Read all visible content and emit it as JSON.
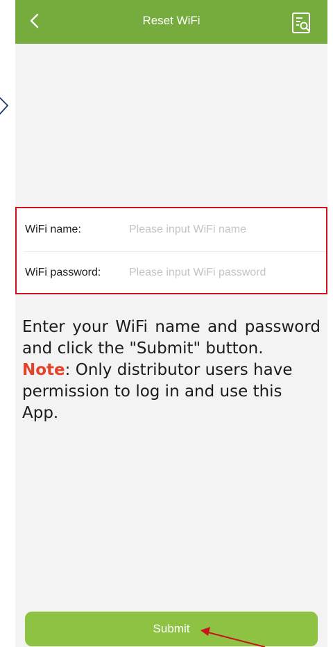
{
  "header": {
    "title": "Reset WiFi",
    "background": "#76ab3d",
    "back_icon": "chevron-left-icon",
    "doc_icon": "document-search-icon"
  },
  "form": {
    "highlight_color": "#c8141a",
    "wifi_name": {
      "label": "WiFi name:",
      "placeholder": "Please input WiFi name",
      "value": ""
    },
    "wifi_password": {
      "label": "WiFi password:",
      "placeholder": "Please input WiFi password",
      "value": ""
    }
  },
  "instructions": {
    "text": "Enter your WiFi name and password and click the \"Submit\" button.",
    "note_label": "Note",
    "note_text": ": Only distributor users have permission to log in and use this App.",
    "note_color": "#e3432b"
  },
  "submit": {
    "label": "Submit",
    "color": "#8dc243"
  },
  "annotations": {
    "arrow_color": "#c8141a"
  }
}
